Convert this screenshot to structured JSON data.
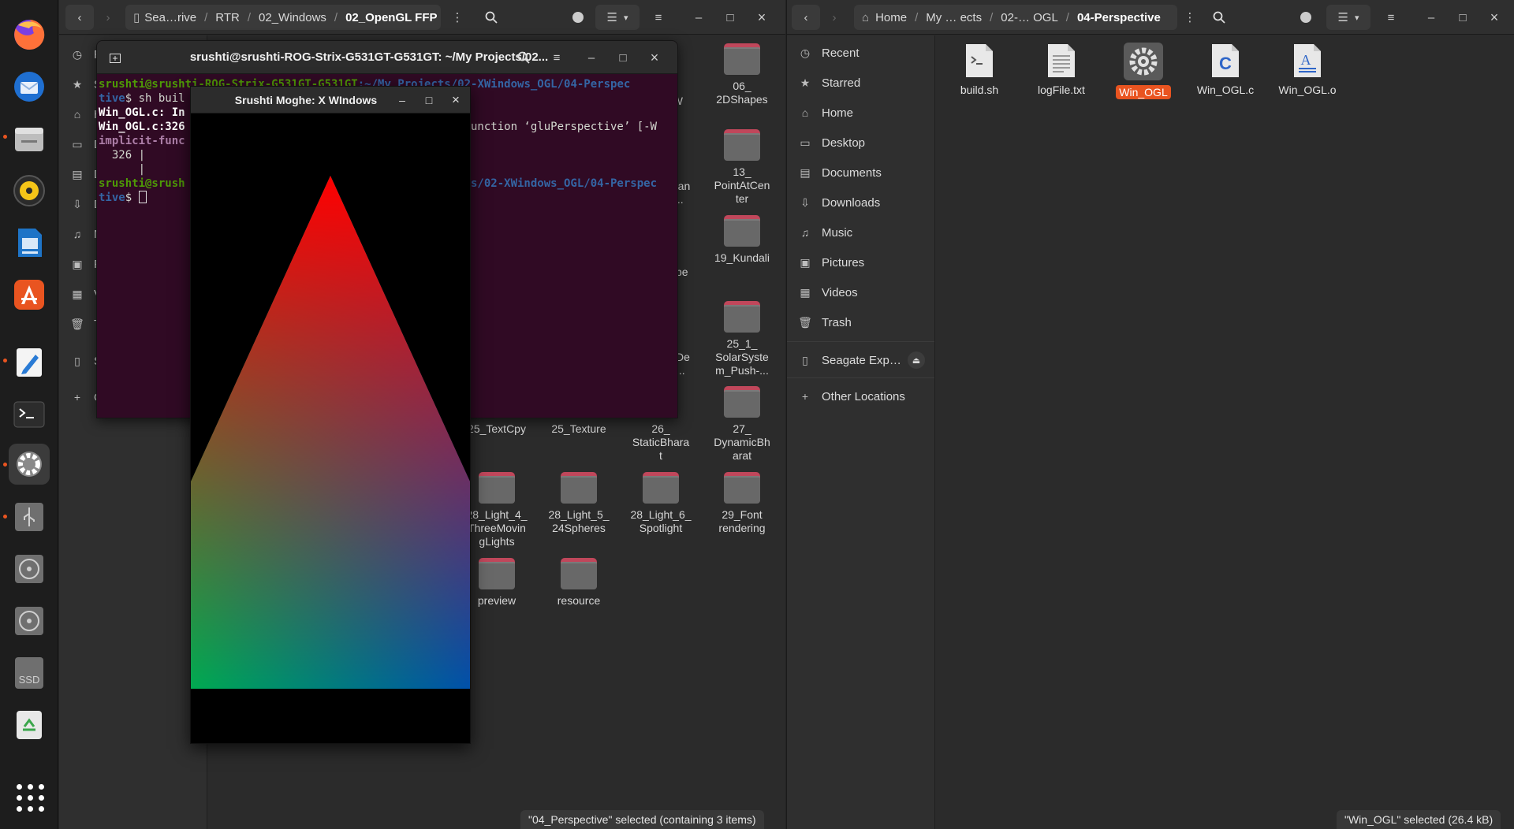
{
  "dock": {
    "items": [
      {
        "name": "firefox"
      },
      {
        "name": "thunderbird"
      },
      {
        "name": "files"
      },
      {
        "name": "rhythmbox"
      },
      {
        "name": "libreoffice-impress"
      },
      {
        "name": "app-center"
      },
      {
        "name": "text-editor"
      },
      {
        "name": "terminal"
      },
      {
        "name": "settings"
      },
      {
        "name": "usb-drive"
      },
      {
        "name": "optical-drive-1"
      },
      {
        "name": "optical-drive-2"
      },
      {
        "name": "ssd-drive"
      },
      {
        "name": "trash"
      }
    ],
    "ssd_label": "SSD",
    "show_apps": "show-apps-grid-icon"
  },
  "left_fm": {
    "path": [
      "Sea…rive",
      "RTR",
      "02_Windows",
      "02_OpenGL FFP"
    ],
    "sidebar": [
      "Re",
      "St",
      "H",
      "D",
      "D",
      "D",
      "M",
      "Pi",
      "V",
      "Tr",
      "Se",
      "O"
    ],
    "folders": [
      {
        "label": "06_\n2DShapes"
      },
      {
        "label": "13_\nPointAtCen\nter"
      },
      {
        "label": "19_Kundali"
      },
      {
        "label": "25_1_\nSolarSyste\nm_Push-..."
      },
      {
        "label": "25_TextCpy"
      },
      {
        "label": "25_Texture"
      },
      {
        "label": "26_\nStaticBhara\nt"
      },
      {
        "label": "27_\nDynamicBh\narat"
      },
      {
        "label": "28_Light_4_\nThreeMovin\ngLights"
      },
      {
        "label": "28_Light_5_\n24Spheres"
      },
      {
        "label": "28_Light_6_\nSpotlight"
      },
      {
        "label": "29_Font\nrendering"
      },
      {
        "label": "preview"
      },
      {
        "label": "resource"
      }
    ],
    "partial_labels": [
      "3W",
      "ran\n...",
      "pe",
      "De\n..."
    ],
    "status": "\"04_Perspective\" selected  (containing 3 items)"
  },
  "right_fm": {
    "path": [
      "Home",
      "My … ects",
      "02-… OGL",
      "04-Perspective"
    ],
    "sidebar": [
      {
        "label": "Recent",
        "icon": "clock-icon"
      },
      {
        "label": "Starred",
        "icon": "star-icon"
      },
      {
        "label": "Home",
        "icon": "home-icon"
      },
      {
        "label": "Desktop",
        "icon": "desktop-icon"
      },
      {
        "label": "Documents",
        "icon": "documents-icon"
      },
      {
        "label": "Downloads",
        "icon": "downloads-icon"
      },
      {
        "label": "Music",
        "icon": "music-icon"
      },
      {
        "label": "Pictures",
        "icon": "pictures-icon"
      },
      {
        "label": "Videos",
        "icon": "videos-icon"
      },
      {
        "label": "Trash",
        "icon": "trash-icon"
      },
      {
        "label": "Seagate Exp…",
        "icon": "drive-icon"
      },
      {
        "label": "Other Locations",
        "icon": "plus-icon"
      }
    ],
    "files": [
      {
        "label": "build.sh",
        "type": "script"
      },
      {
        "label": "logFile.txt",
        "type": "text"
      },
      {
        "label": "Win_OGL",
        "type": "executable",
        "selected": true
      },
      {
        "label": "Win_OGL.c",
        "type": "c-source"
      },
      {
        "label": "Win_OGL.o",
        "type": "object"
      }
    ],
    "status": "\"Win_OGL\" selected  (26.4 kB)"
  },
  "terminal": {
    "title": "srushti@srushti-ROG-Strix-G531GT-G531GT: ~/My Projects/02...",
    "lines": [
      {
        "user": "srushti@srushti-ROG-Strix-G531GT-G531GT",
        "path": ":~/My Projects/02-XWindows_OGL/04-Perspec"
      },
      {
        "path": "tive",
        "cmd": "$ sh buil"
      },
      {
        "text": "Win_OGL.c: In"
      },
      {
        "text": "Win_OGL.c:326",
        "rest": "unction ‘gluPerspective’ [-W"
      },
      {
        "text": "implicit-func"
      },
      {
        "text": "  326 |"
      },
      {
        "text": "      |"
      },
      {
        "user": "srushti@srush",
        "path": "s/02-XWindows_OGL/04-Perspec"
      },
      {
        "path": "tive",
        "cmd": "$ "
      }
    ]
  },
  "glwindow": {
    "title": "Srushti Moghe: X WIndows",
    "colors": {
      "top": "#ff0000",
      "left": "#00c832",
      "right": "#0032c8",
      "background": "#000000"
    }
  },
  "window_controls": {
    "minimize": "–",
    "maximize": "□",
    "close": "×"
  }
}
